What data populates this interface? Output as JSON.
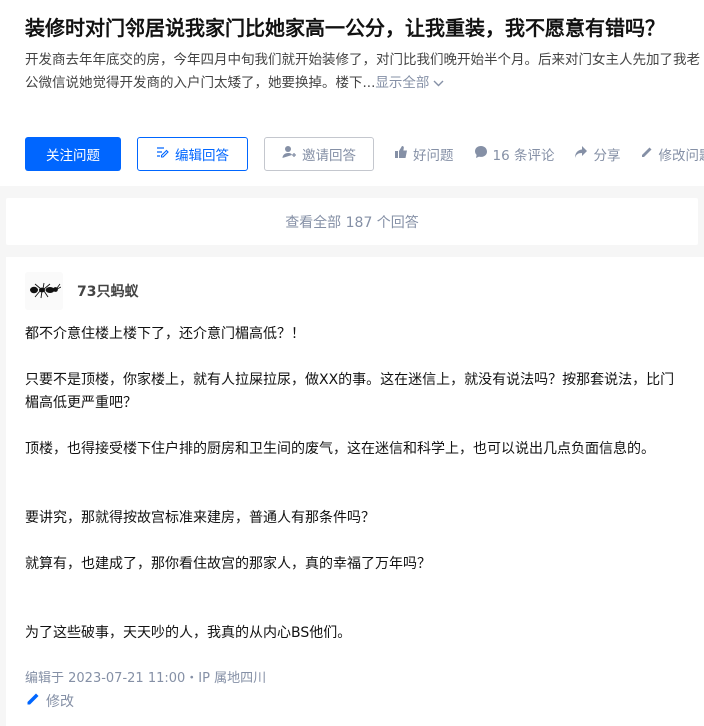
{
  "question": {
    "title": "装修时对门邻居说我家门比她家高一公分，让我重装，我不愿意有错吗？",
    "excerpt": "开发商去年年底交的房，今年四月中旬我们就开始装修了，对门比我们晚开始半个月。后来对门女主人先加了我老公微信说她觉得开发商的入户门太矮了，她要换掉。楼下...",
    "show_all": "显示全部",
    "actions": {
      "follow": "关注问题",
      "write": "编辑回答",
      "invite": "邀请回答",
      "good": "好问题",
      "comments": "16 条评论",
      "share": "分享",
      "edit": "修改问题"
    }
  },
  "view_all": "查看全部 187 个回答",
  "answer": {
    "author": "73只蚂蚁",
    "paragraphs": [
      "都不介意住楼上楼下了，还介意门楣高低？！",
      "只要不是顶楼，你家楼上，就有人拉屎拉尿，做XX的事。这在迷信上，就没有说法吗？按那套说法，比门楣高低更严重吧？",
      "顶楼，也得接受楼下住户排的厨房和卫生间的废气，这在迷信和科学上，也可以说出几点负面信息的。",
      "要讲究，那就得按故宫标准来建房，普通人有那条件吗？",
      "就算有，也建成了，那你看住故宫的那家人，真的幸福了万年吗？",
      "为了这些破事，天天吵的人，我真的从内心BS他们。"
    ],
    "edit_time": "编辑于 2023-07-21 11:00・IP 属地四川",
    "edit_label": "修改"
  },
  "colors": {
    "accent": "#0066ff",
    "muted": "#8590a6"
  },
  "icons": [
    "ant-avatar-icon",
    "edit-icon",
    "invite-icon",
    "thumb-up-icon",
    "comment-icon",
    "share-icon",
    "pencil-icon",
    "chevron-down-icon"
  ]
}
